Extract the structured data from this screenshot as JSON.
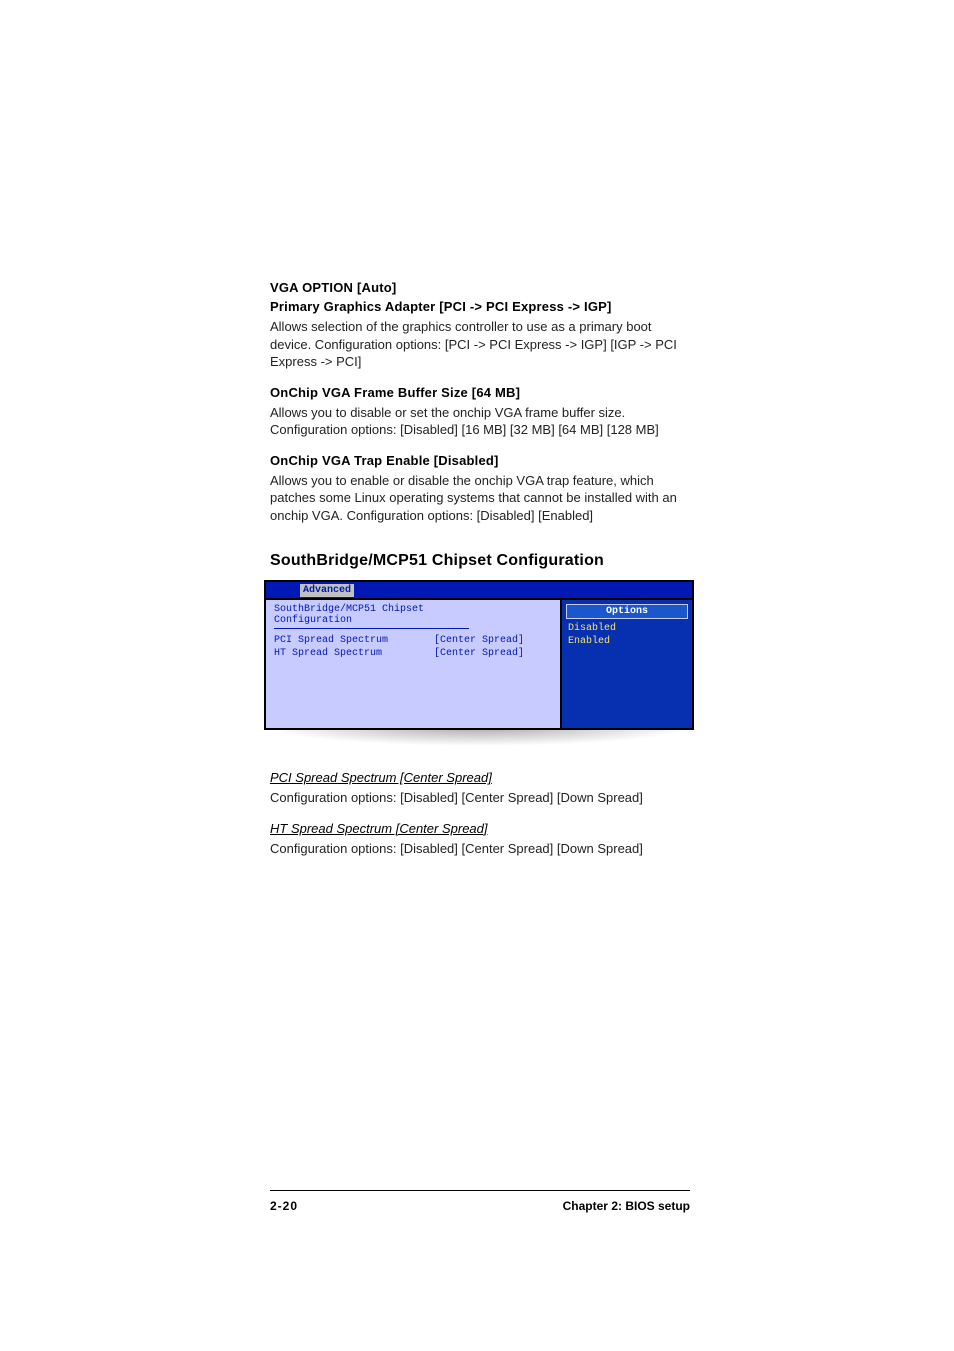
{
  "sections": {
    "vga_option": {
      "title": "VGA OPTION [Auto]"
    },
    "primary_graphics": {
      "title": "Primary Graphics Adapter [PCI -> PCI Express -> IGP]",
      "body": "Allows selection of the graphics controller to use as a primary boot device. Configuration options: [PCI -> PCI Express -> IGP] [IGP -> PCI Express -> PCI]"
    },
    "frame_buffer": {
      "title": "OnChip VGA Frame Buffer Size [64 MB]",
      "body": "Allows you to disable or set the onchip VGA frame buffer size. Configuration options: [Disabled] [16 MB] [32 MB] [64 MB] [128 MB]"
    },
    "trap_enable": {
      "title": "OnChip VGA Trap Enable [Disabled]",
      "body": "Allows you to enable or disable the onchip VGA trap feature, which patches some Linux operating systems that cannot be installed with an onchip VGA. Configuration options: [Disabled] [Enabled]"
    },
    "southbridge": {
      "heading": "SouthBridge/MCP51 Chipset Configuration"
    },
    "pci_spread": {
      "title": "PCI Spread Spectrum [Center Spread]",
      "body": "Configuration options: [Disabled] [Center Spread] [Down Spread]"
    },
    "ht_spread": {
      "title": "HT Spread Spectrum [Center Spread]",
      "body": "Configuration options: [Disabled] [Center Spread] [Down Spread]"
    }
  },
  "bios": {
    "tab": "Advanced",
    "panel_title": "SouthBridge/MCP51 Chipset Configuration",
    "rows": [
      {
        "label": "PCI Spread Spectrum",
        "value": "[Center Spread]"
      },
      {
        "label": "HT Spread Spectrum",
        "value": "[Center Spread]"
      }
    ],
    "options_title": "Options",
    "options": [
      "Disabled",
      "Enabled"
    ]
  },
  "footer": {
    "page": "2-20",
    "chapter": "Chapter 2: BIOS setup"
  }
}
